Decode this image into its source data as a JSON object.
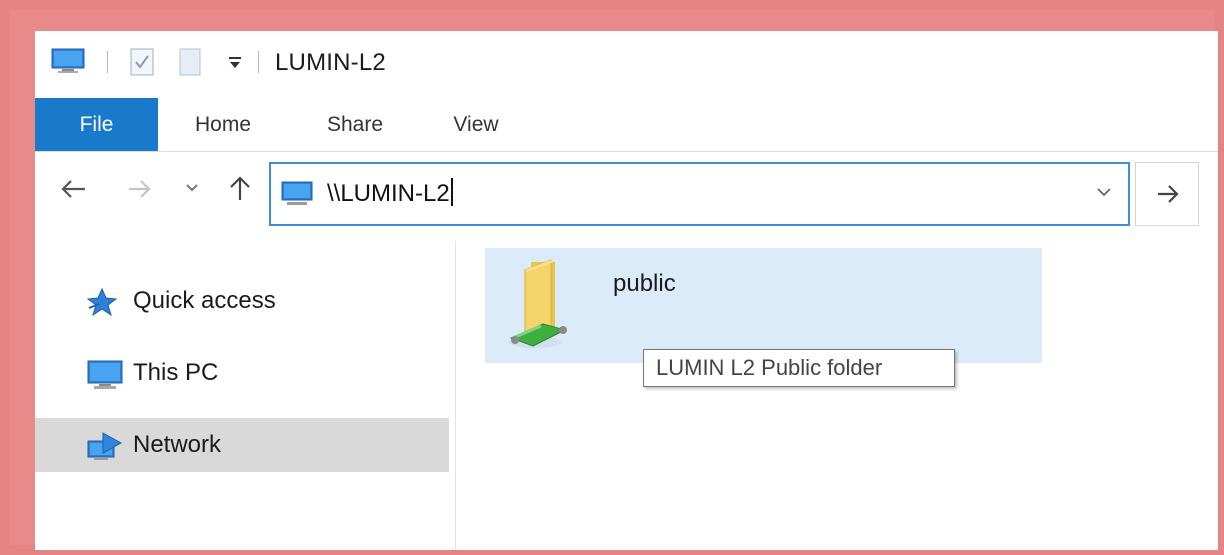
{
  "window": {
    "title": "LUMIN-L2"
  },
  "icons": {
    "quick_access_toolbar": [
      "computer-icon",
      "properties-icon",
      "new-folder-icon",
      "customize-toolbar-icon"
    ],
    "navigation": [
      "back-arrow-icon",
      "forward-arrow-icon",
      "recent-locations-icon",
      "up-arrow-icon"
    ]
  },
  "ribbon": {
    "tabs": [
      {
        "label": "File",
        "active": true
      },
      {
        "label": "Home"
      },
      {
        "label": "Share"
      },
      {
        "label": "View"
      }
    ]
  },
  "address_bar": {
    "value": "\\\\LUMIN-L2"
  },
  "navigation_pane": {
    "items": [
      {
        "label": "Quick access",
        "icon": "star-icon"
      },
      {
        "label": "This PC",
        "icon": "computer-icon"
      },
      {
        "label": "Network",
        "icon": "network-icon",
        "selected": true
      }
    ]
  },
  "content": {
    "items": [
      {
        "name": "public",
        "icon": "shared-folder-icon",
        "tooltip": "LUMIN L2 Public folder"
      }
    ]
  },
  "colors": {
    "accent": "#1979ca",
    "frame": "#e98a8a",
    "selection": "#dcebf9",
    "nav_selected": "#d9d9d9"
  }
}
